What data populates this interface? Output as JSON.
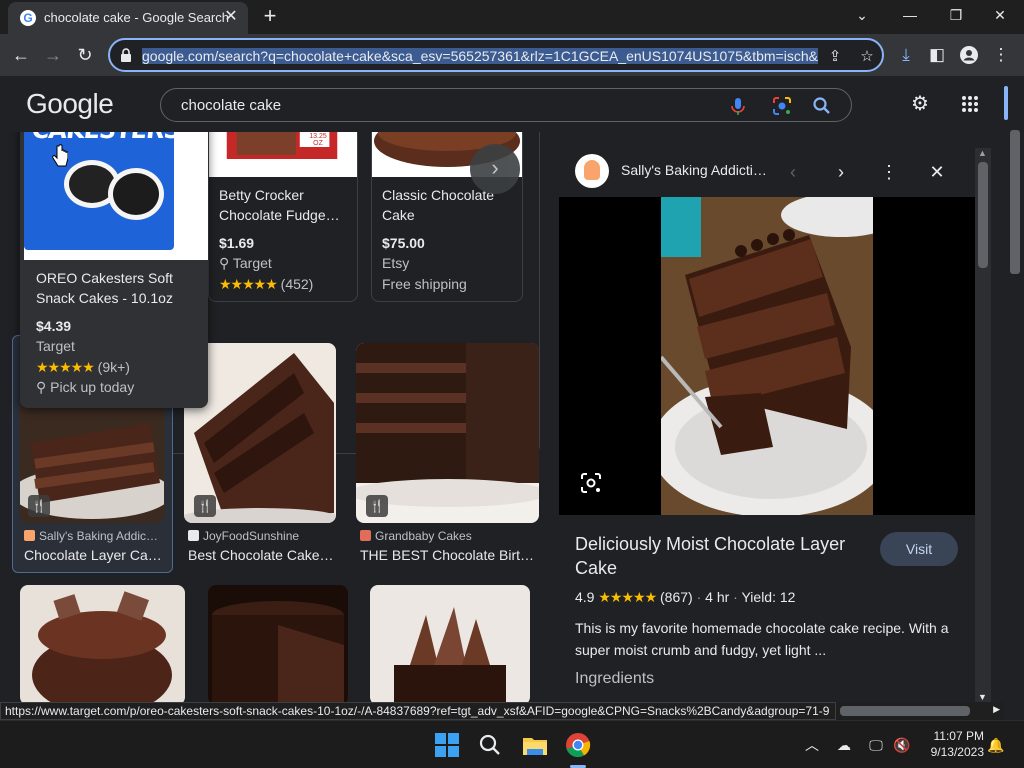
{
  "browser": {
    "tab_title": "chocolate cake - Google Search",
    "url_display": "google.com/search?q=chocolate+cake&sca_esv=565257361&rlz=1C1GCEA_enUS1074US1075&tbm=isch&sc",
    "status_url": "https://www.target.com/p/oreo-cakesters-soft-snack-cakes-10-1oz/-/A-84837689?ref=tgt_adv_xsf&AFID=google&CPNG=Snacks%2BCandy&adgroup=71-9"
  },
  "google": {
    "logo": "Google",
    "query": "chocolate cake"
  },
  "shopping": {
    "hover_card": {
      "box_label": "CAKESTERS",
      "title_line1": "OREO Cakesters Soft",
      "title_line2": "Snack Cakes - 10.1oz",
      "price": "$4.39",
      "store": "Target",
      "stars": "★★★★★",
      "reviews": "(9k+)",
      "pickup": "Pick up today"
    },
    "products": [
      {
        "title_line1": "Betty Crocker",
        "title_line2": "Chocolate Fudge…",
        "price": "$1.69",
        "store": "Target",
        "stars": "★★★★★",
        "reviews": "(452)",
        "box_badge": "13.25 OZ"
      },
      {
        "title_line1": "Classic Chocolate",
        "title_line2": "Cake",
        "price": "$75.00",
        "store": "Etsy",
        "extra": "Free shipping"
      }
    ],
    "next_arrow": "›"
  },
  "images": [
    {
      "source": "Sally's Baking Addic…",
      "title": "Chocolate Layer Ca…",
      "fav_color": "#f8a46b"
    },
    {
      "source": "JoyFoodSunshine",
      "title": "Best Chocolate Cake…",
      "fav_color": "#e8eaed"
    },
    {
      "source": "Grandbaby Cakes",
      "title": "THE BEST Chocolate Birt…",
      "fav_color": "#e06c5a"
    }
  ],
  "side_panel": {
    "site_name": "Sally's Baking Addicti…",
    "title": "Deliciously Moist Chocolate Layer Cake",
    "visit_label": "Visit",
    "rating": "4.9",
    "stars": "★★★★★",
    "reviews": "(867)",
    "time": "4 hr",
    "yield": "Yield: 12",
    "description": "This is my favorite homemade chocolate cake recipe. With a super moist crumb and fudgy, yet light ...",
    "ingredients_label": "Ingredients"
  },
  "taskbar": {
    "time": "11:07 PM",
    "date": "9/13/2023"
  },
  "colors": {
    "accent": "#8ab4f8",
    "star": "#fbbc04",
    "bg": "#202124"
  }
}
